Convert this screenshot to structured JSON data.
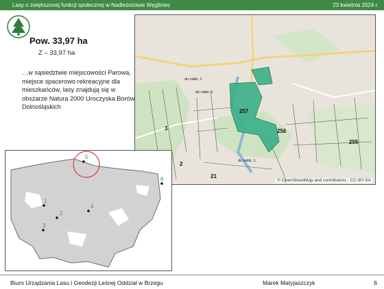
{
  "header": {
    "title": "Lasy o zwiększonej funkcji społecznej w Nadleśnictwie Węgliniec",
    "date": "23 kwietnia 2024 r."
  },
  "info": {
    "area": "Pow. 33,97 ha",
    "z_area": "Z – 33,97 ha",
    "description": "…w sąsiedztwie miejscowości Parowa, miejsce spacerowo rekreacyjne dla mieszkańców, lasy znajdują się w obszarze Natura 2000 Uroczyska Borów Dolnośląskich"
  },
  "big_map": {
    "attribution": "© OpenStreetMap and contributors , CC-BY-SA",
    "compartments": [
      "257",
      "256",
      "255",
      "3",
      "2",
      "21"
    ],
    "labels": [
      "do oddz. 1",
      "do oddz. 1",
      "do oddz. 1"
    ]
  },
  "small_map": {
    "points": [
      "1",
      "2",
      "3",
      "4",
      "5",
      "6"
    ]
  },
  "footer": {
    "org": "Biuro Urządzania Lasu i Geodezji Leśnej Oddział w Brzegu",
    "author": "Marek Matyjaszczyk",
    "page": "6"
  },
  "colors": {
    "header_bg": "#3e8a45",
    "forest_highlight": "#3bb088",
    "point_label": "#2fa33a",
    "circle": "#d23a3a"
  }
}
